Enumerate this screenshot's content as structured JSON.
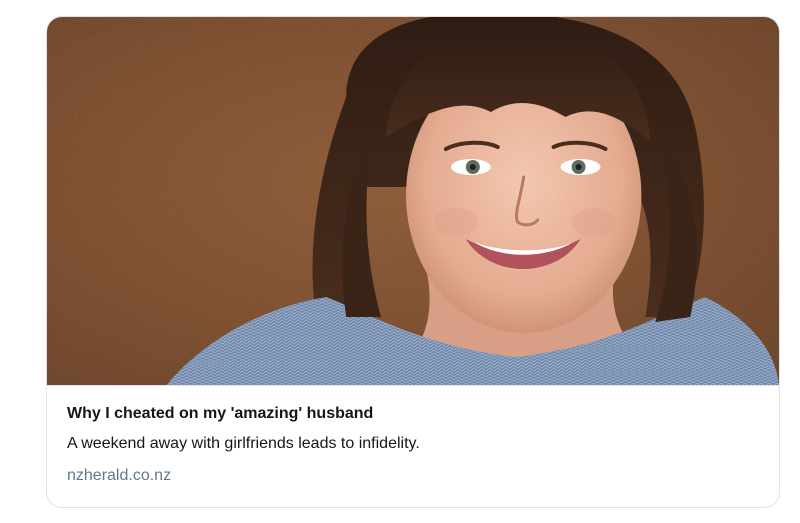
{
  "card": {
    "image_alt": "Smiling woman with bangs against a rusty wall",
    "title": "Why I cheated on my 'amazing' husband",
    "description": "A weekend away with girlfriends leads to infidelity.",
    "domain": "nzherald.co.nz"
  },
  "colors": {
    "title_text": "#14171a",
    "domain_text": "#657786",
    "border": "#dfe3e8",
    "rust_background": "#7a4a2c",
    "hair": "#3a2418",
    "sweater": "#6f86a8",
    "skin": "#e9b9a1"
  }
}
